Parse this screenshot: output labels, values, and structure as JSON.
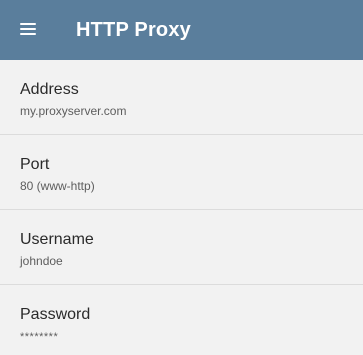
{
  "app_bar": {
    "title": "HTTP Proxy",
    "menu_icon": "hamburger-menu-icon",
    "background_color": "#5a7e9c"
  },
  "settings": [
    {
      "label": "Address",
      "value": "my.proxyserver.com"
    },
    {
      "label": "Port",
      "value": "80 (www-http)"
    },
    {
      "label": "Username",
      "value": "johndoe"
    },
    {
      "label": "Password",
      "value": "********"
    }
  ]
}
